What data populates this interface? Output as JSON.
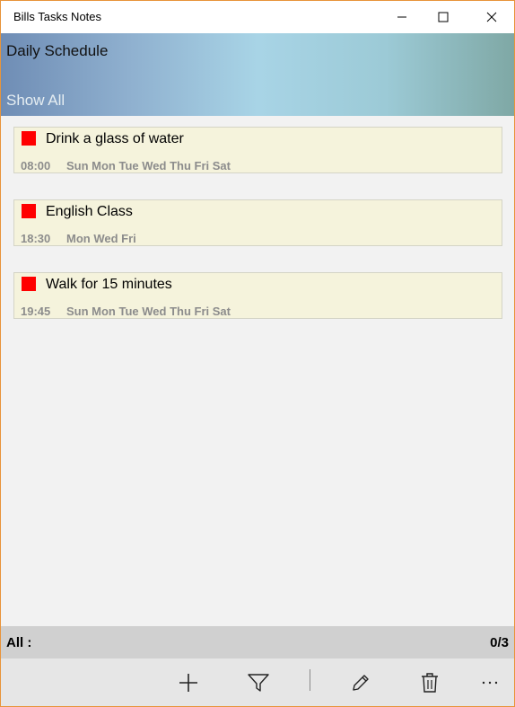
{
  "window": {
    "title": "Bills Tasks Notes",
    "controls": [
      "minimize-icon",
      "maximize-icon",
      "close-icon"
    ]
  },
  "header": {
    "title": "Daily Schedule",
    "filter_label": "Show All"
  },
  "tasks": [
    {
      "title": "Drink a glass of water",
      "time": "08:00",
      "days": "Sun Mon Tue Wed Thu Fri Sat",
      "flag_color": "#ff0000"
    },
    {
      "title": "English Class",
      "time": "18:30",
      "days": "Mon Wed Fri",
      "flag_color": "#ff0000"
    },
    {
      "title": "Walk for 15 minutes",
      "time": "19:45",
      "days": "Sun Mon Tue Wed Thu Fri Sat",
      "flag_color": "#ff0000"
    }
  ],
  "status": {
    "label": "All :",
    "count": "0/3"
  },
  "command_bar": {
    "buttons": [
      "add-icon",
      "filter-icon",
      "edit-icon",
      "delete-icon",
      "more-icon"
    ]
  },
  "colors": {
    "accent_border": "#e8943a",
    "task_background": "#f5f3dc",
    "flag": "#ff0000"
  }
}
